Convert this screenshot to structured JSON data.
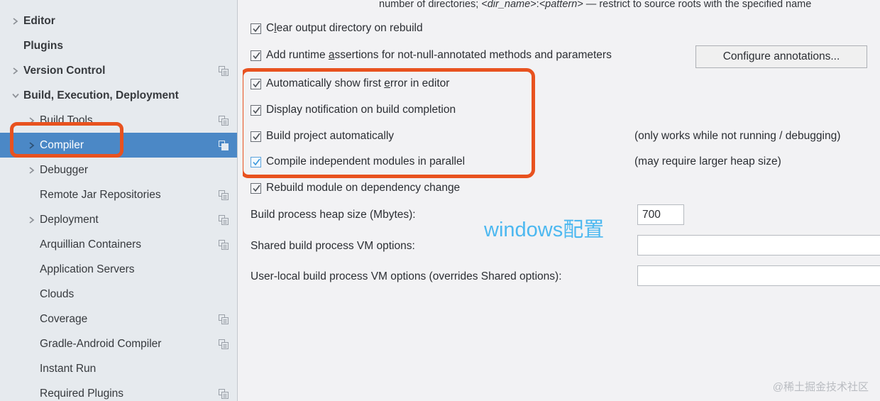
{
  "sidebar": {
    "scroll": {
      "visible": true
    },
    "items": [
      {
        "label": "",
        "level": 0,
        "arrow": "none",
        "copy": false,
        "selected": false,
        "partial": true
      },
      {
        "label": "Editor",
        "level": 0,
        "arrow": "collapsed",
        "copy": false,
        "selected": false
      },
      {
        "label": "Plugins",
        "level": 0,
        "arrow": "none",
        "copy": false,
        "selected": false
      },
      {
        "label": "Version Control",
        "level": 0,
        "arrow": "collapsed",
        "copy": true,
        "selected": false
      },
      {
        "label": "Build, Execution, Deployment",
        "level": 0,
        "arrow": "expanded",
        "copy": false,
        "selected": false
      },
      {
        "label": "Build Tools",
        "level": 1,
        "arrow": "collapsed",
        "copy": true,
        "selected": false
      },
      {
        "label": "Compiler",
        "level": 1,
        "arrow": "collapsed",
        "copy": true,
        "selected": true
      },
      {
        "label": "Debugger",
        "level": 1,
        "arrow": "collapsed",
        "copy": false,
        "selected": false
      },
      {
        "label": "Remote Jar Repositories",
        "level": 1,
        "arrow": "none",
        "copy": true,
        "selected": false
      },
      {
        "label": "Deployment",
        "level": 1,
        "arrow": "collapsed",
        "copy": true,
        "selected": false
      },
      {
        "label": "Arquillian Containers",
        "level": 1,
        "arrow": "none",
        "copy": true,
        "selected": false
      },
      {
        "label": "Application Servers",
        "level": 1,
        "arrow": "none",
        "copy": false,
        "selected": false
      },
      {
        "label": "Clouds",
        "level": 1,
        "arrow": "none",
        "copy": false,
        "selected": false
      },
      {
        "label": "Coverage",
        "level": 1,
        "arrow": "none",
        "copy": true,
        "selected": false
      },
      {
        "label": "Gradle-Android Compiler",
        "level": 1,
        "arrow": "none",
        "copy": true,
        "selected": false
      },
      {
        "label": "Instant Run",
        "level": 1,
        "arrow": "none",
        "copy": false,
        "selected": false
      },
      {
        "label": "Required Plugins",
        "level": 1,
        "arrow": "none",
        "copy": true,
        "selected": false
      }
    ]
  },
  "main": {
    "hint": {
      "prefix": "number of directories; ",
      "italic1": "<dir_name>",
      "mid": ":",
      "italic2": "<pattern>",
      "suffix": " — restrict to source roots with the specified name"
    },
    "checkboxes": [
      {
        "label": "Clear output directory on rebuild",
        "checked": true,
        "focused": false
      },
      {
        "label": "Add runtime assertions for not-null-annotated methods and parameters",
        "checked": true,
        "focused": false
      },
      {
        "label": "Automatically show first error in editor",
        "checked": true,
        "focused": false
      },
      {
        "label": "Display notification on build completion",
        "checked": true,
        "focused": false
      },
      {
        "label": "Build project automatically",
        "checked": true,
        "focused": false
      },
      {
        "label": "Compile independent modules in parallel",
        "checked": true,
        "focused": true
      },
      {
        "label": "Rebuild module on dependency change",
        "checked": true,
        "focused": false
      }
    ],
    "side_notes": [
      {
        "text": "(only works while not running / debugging)"
      },
      {
        "text": "(may require larger heap size)"
      }
    ],
    "configure_button": "Configure annotations...",
    "fields": [
      {
        "label": "Build process heap size (Mbytes):",
        "value": "700",
        "placeholder": ""
      },
      {
        "label": "Shared build process VM options:",
        "value": "",
        "placeholder": ""
      },
      {
        "label": "User-local build process VM options (overrides Shared options):",
        "value": "",
        "placeholder": ""
      }
    ]
  },
  "annotations": {
    "windows_text": "windows配置",
    "watermark": "@稀土掘金技术社区",
    "highlight_color": "#e8521f",
    "annotation_text_color": "#4cb8f0"
  }
}
